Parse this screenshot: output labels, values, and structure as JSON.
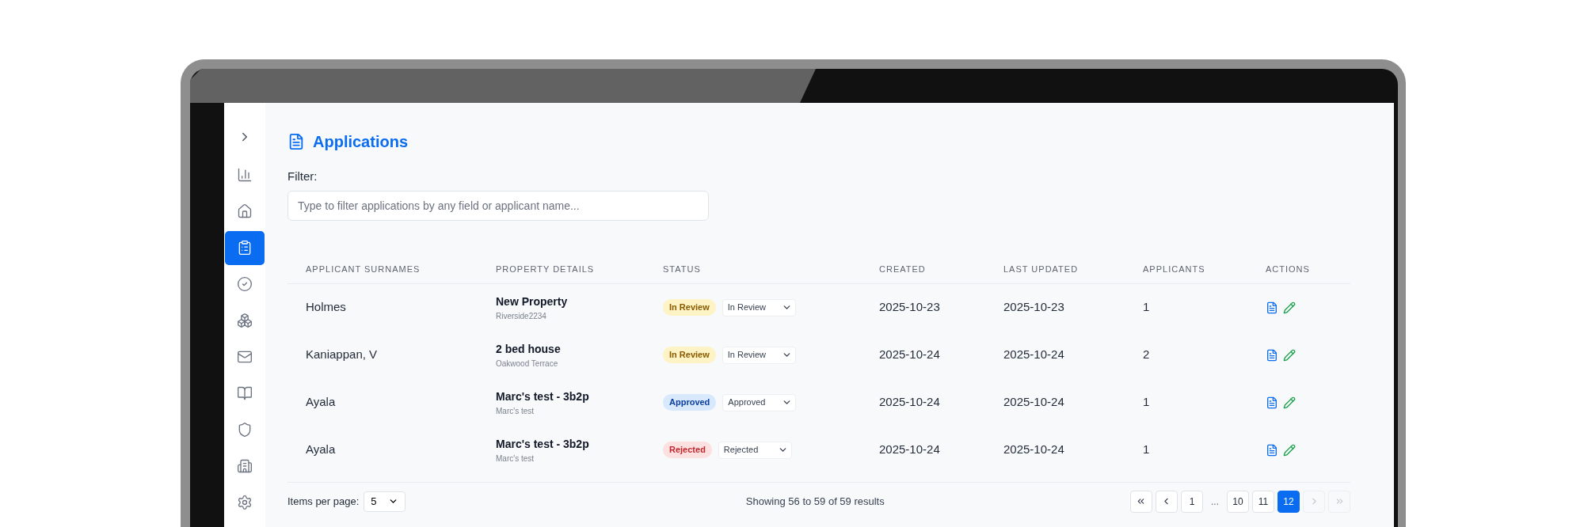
{
  "sidebar": {
    "toggle": {
      "expanded": false
    },
    "items": [
      {
        "selected": false
      },
      {
        "selected": false
      },
      {
        "selected": true
      },
      {
        "selected": false
      },
      {
        "selected": false
      },
      {
        "selected": false
      },
      {
        "selected": false
      },
      {
        "selected": false
      },
      {
        "selected": false
      },
      {
        "selected": false
      }
    ]
  },
  "page": {
    "title": "Applications"
  },
  "filter": {
    "label": "Filter:",
    "placeholder": "Type to filter applications by any field or applicant name..."
  },
  "table": {
    "columns": [
      "APPLICANT SURNAMES",
      "PROPERTY DETAILS",
      "STATUS",
      "CREATED",
      "LAST UPDATED",
      "APPLICANTS",
      "ACTIONS"
    ],
    "rows": [
      {
        "surname": "Holmes",
        "property": "New Property",
        "location": "Riverside2234",
        "status": {
          "kind": "review",
          "badge": "In Review",
          "value": "In Review"
        },
        "created": "2025-10-23",
        "updated": "2025-10-23",
        "applicants": "1"
      },
      {
        "surname": "Kaniappan, V",
        "property": "2 bed house",
        "location": "Oakwood Terrace",
        "status": {
          "kind": "review",
          "badge": "In Review",
          "value": "In Review"
        },
        "created": "2025-10-24",
        "updated": "2025-10-24",
        "applicants": "2"
      },
      {
        "surname": "Ayala",
        "property": "Marc's test - 3b2p",
        "location": "Marc's test",
        "status": {
          "kind": "approved",
          "badge": "Approved",
          "value": "Approved"
        },
        "created": "2025-10-24",
        "updated": "2025-10-24",
        "applicants": "1"
      },
      {
        "surname": "Ayala",
        "property": "Marc's test - 3b2p",
        "location": "Marc's test",
        "status": {
          "kind": "rejected",
          "badge": "Rejected",
          "value": "Rejected"
        },
        "created": "2025-10-24",
        "updated": "2025-10-24",
        "applicants": "1"
      }
    ]
  },
  "footer": {
    "items_per_page_label": "Items per page:",
    "items_per_page": "5",
    "summary": "Showing 56 to 59 of 59 results"
  },
  "pagination": {
    "buttons": [
      {
        "kind": "first",
        "disabled": false
      },
      {
        "kind": "prev",
        "disabled": false
      },
      {
        "kind": "page",
        "label": "1",
        "selected": false
      },
      {
        "kind": "gap",
        "label": "..."
      },
      {
        "kind": "page",
        "label": "10",
        "selected": false
      },
      {
        "kind": "page",
        "label": "11",
        "selected": false
      },
      {
        "kind": "page",
        "label": "12",
        "selected": true
      },
      {
        "kind": "next",
        "disabled": true
      },
      {
        "kind": "last",
        "disabled": true
      }
    ]
  }
}
